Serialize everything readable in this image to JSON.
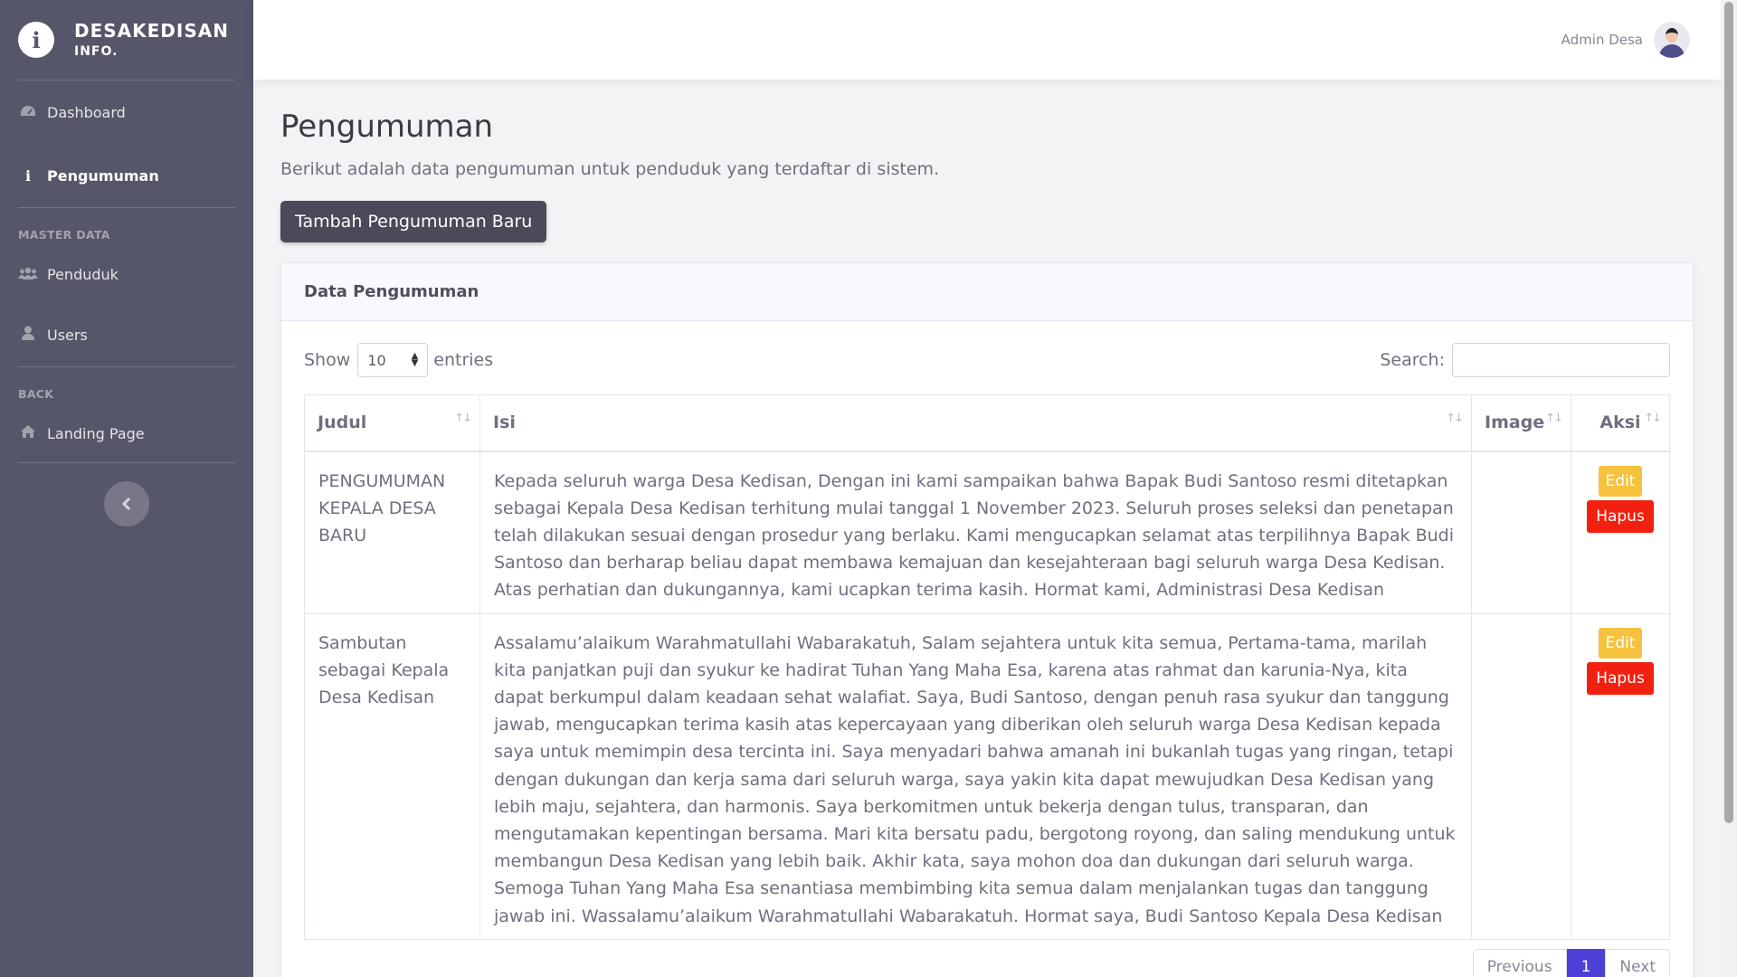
{
  "brand": {
    "icon": "info-icon",
    "line1": "DESAKEDISAN",
    "line2": "INFO."
  },
  "sidebar": {
    "items": [
      {
        "label": "Dashboard",
        "icon": "tachometer-icon",
        "active": false
      },
      {
        "label": "Pengumuman",
        "icon": "info-icon",
        "active": true
      }
    ],
    "master_heading": "MASTER DATA",
    "master_items": [
      {
        "label": "Penduduk",
        "icon": "users-icon"
      },
      {
        "label": "Users",
        "icon": "user-icon"
      }
    ],
    "back_heading": "BACK",
    "back_items": [
      {
        "label": "Landing Page",
        "icon": "home-icon"
      }
    ],
    "toggle_icon": "chevron-left-icon"
  },
  "topbar": {
    "user_name": "Admin Desa",
    "avatar": "avatar-icon"
  },
  "page": {
    "title": "Pengumuman",
    "description": "Berikut adalah data pengumuman untuk penduduk yang terdaftar di sistem.",
    "add_button": "Tambah Pengumuman Baru"
  },
  "card": {
    "title": "Data Pengumuman",
    "show_label": "Show",
    "entries_value": "10",
    "entries_label": "entries",
    "search_label": "Search:",
    "search_value": ""
  },
  "table": {
    "columns": [
      "Judul",
      "Isi",
      "Image",
      "Aksi"
    ],
    "rows": [
      {
        "judul": "PENGUMUMAN KEPALA DESA BARU",
        "isi": "Kepada seluruh warga Desa Kedisan, Dengan ini kami sampaikan bahwa Bapak Budi Santoso resmi ditetapkan sebagai Kepala Desa Kedisan terhitung mulai tanggal 1 November 2023. Seluruh proses seleksi dan penetapan telah dilakukan sesuai dengan prosedur yang berlaku. Kami mengucapkan selamat atas terpilihnya Bapak Budi Santoso dan berharap beliau dapat membawa kemajuan dan kesejahteraan bagi seluruh warga Desa Kedisan. Atas perhatian dan dukungannya, kami ucapkan terima kasih. Hormat kami, Administrasi Desa Kedisan",
        "image": "",
        "edit_label": "Edit",
        "delete_label": "Hapus"
      },
      {
        "judul": "Sambutan sebagai Kepala Desa Kedisan",
        "isi": "Assalamu’alaikum Warahmatullahi Wabarakatuh, Salam sejahtera untuk kita semua, Pertama-tama, marilah kita panjatkan puji dan syukur ke hadirat Tuhan Yang Maha Esa, karena atas rahmat dan karunia-Nya, kita dapat berkumpul dalam keadaan sehat walafiat. Saya, Budi Santoso, dengan penuh rasa syukur dan tanggung jawab, mengucapkan terima kasih atas kepercayaan yang diberikan oleh seluruh warga Desa Kedisan kepada saya untuk memimpin desa tercinta ini. Saya menyadari bahwa amanah ini bukanlah tugas yang ringan, tetapi dengan dukungan dan kerja sama dari seluruh warga, saya yakin kita dapat mewujudkan Desa Kedisan yang lebih maju, sejahtera, dan harmonis. Saya berkomitmen untuk bekerja dengan tulus, transparan, dan mengutamakan kepentingan bersama. Mari kita bersatu padu, bergotong royong, dan saling mendukung untuk membangun Desa Kedisan yang lebih baik. Akhir kata, saya mohon doa dan dukungan dari seluruh warga. Semoga Tuhan Yang Maha Esa senantiasa membimbing kita semua dalam menjalankan tugas dan tanggung jawab ini. Wassalamu’alaikum Warahmatullahi Wabarakatuh. Hormat saya, Budi Santoso Kepala Desa Kedisan",
        "image": "",
        "edit_label": "Edit",
        "delete_label": "Hapus"
      }
    ]
  },
  "pagination": {
    "previous": "Previous",
    "current": "1",
    "next": "Next"
  }
}
